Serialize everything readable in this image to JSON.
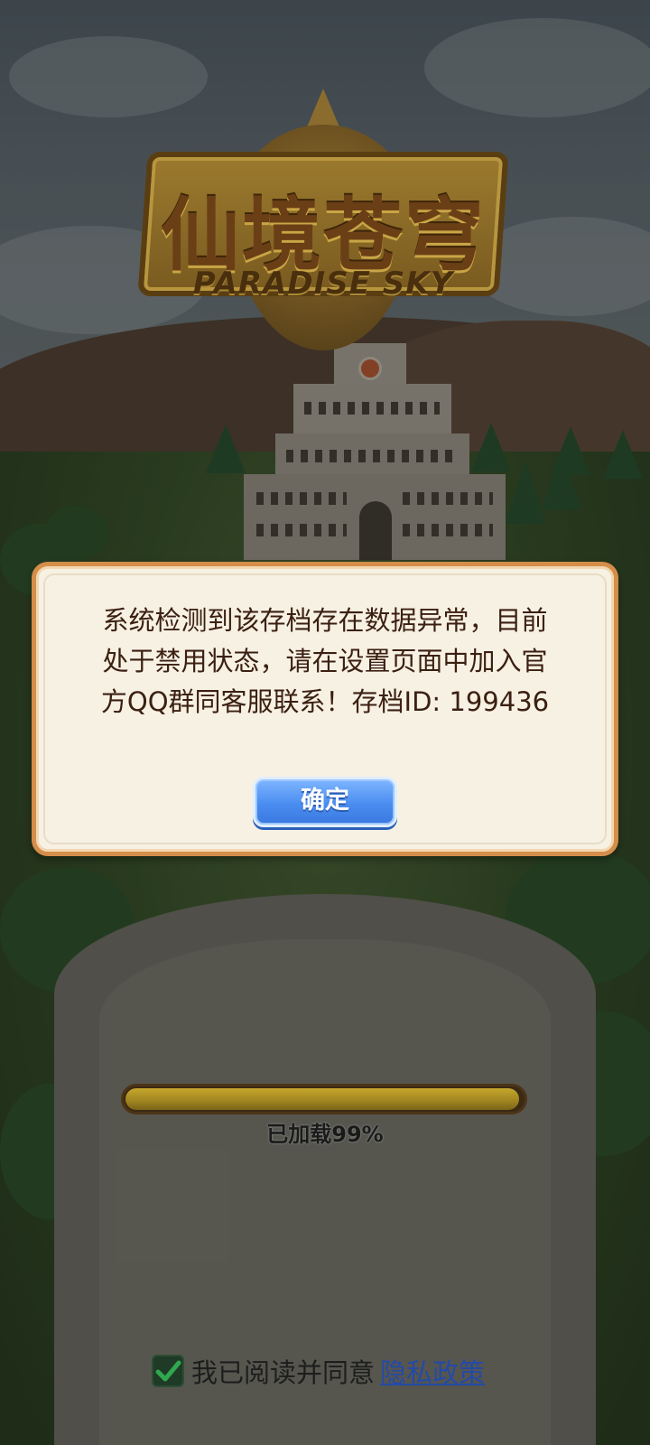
{
  "logo": {
    "title": "仙境苍穹",
    "subtitle": "PARADISE SKY"
  },
  "dialog": {
    "message": "系统检测到该存档存在数据异常，目前处于禁用状态，请在设置页面中加入官方QQ群同客服联系！存档ID: 199436",
    "confirm_label": "确定"
  },
  "loading": {
    "progress": 0.99,
    "label": "已加载99%"
  },
  "agreement": {
    "checked": true,
    "text": "我已阅读并同意",
    "link_text": "隐私政策",
    "check_icon": "checkmark-icon",
    "accent_color": "#2fa84f"
  },
  "colors": {
    "dialog_border": "#d48e4a",
    "dialog_bg": "#f7f1e4",
    "button": "#4a8df0",
    "link": "#244aa8"
  }
}
